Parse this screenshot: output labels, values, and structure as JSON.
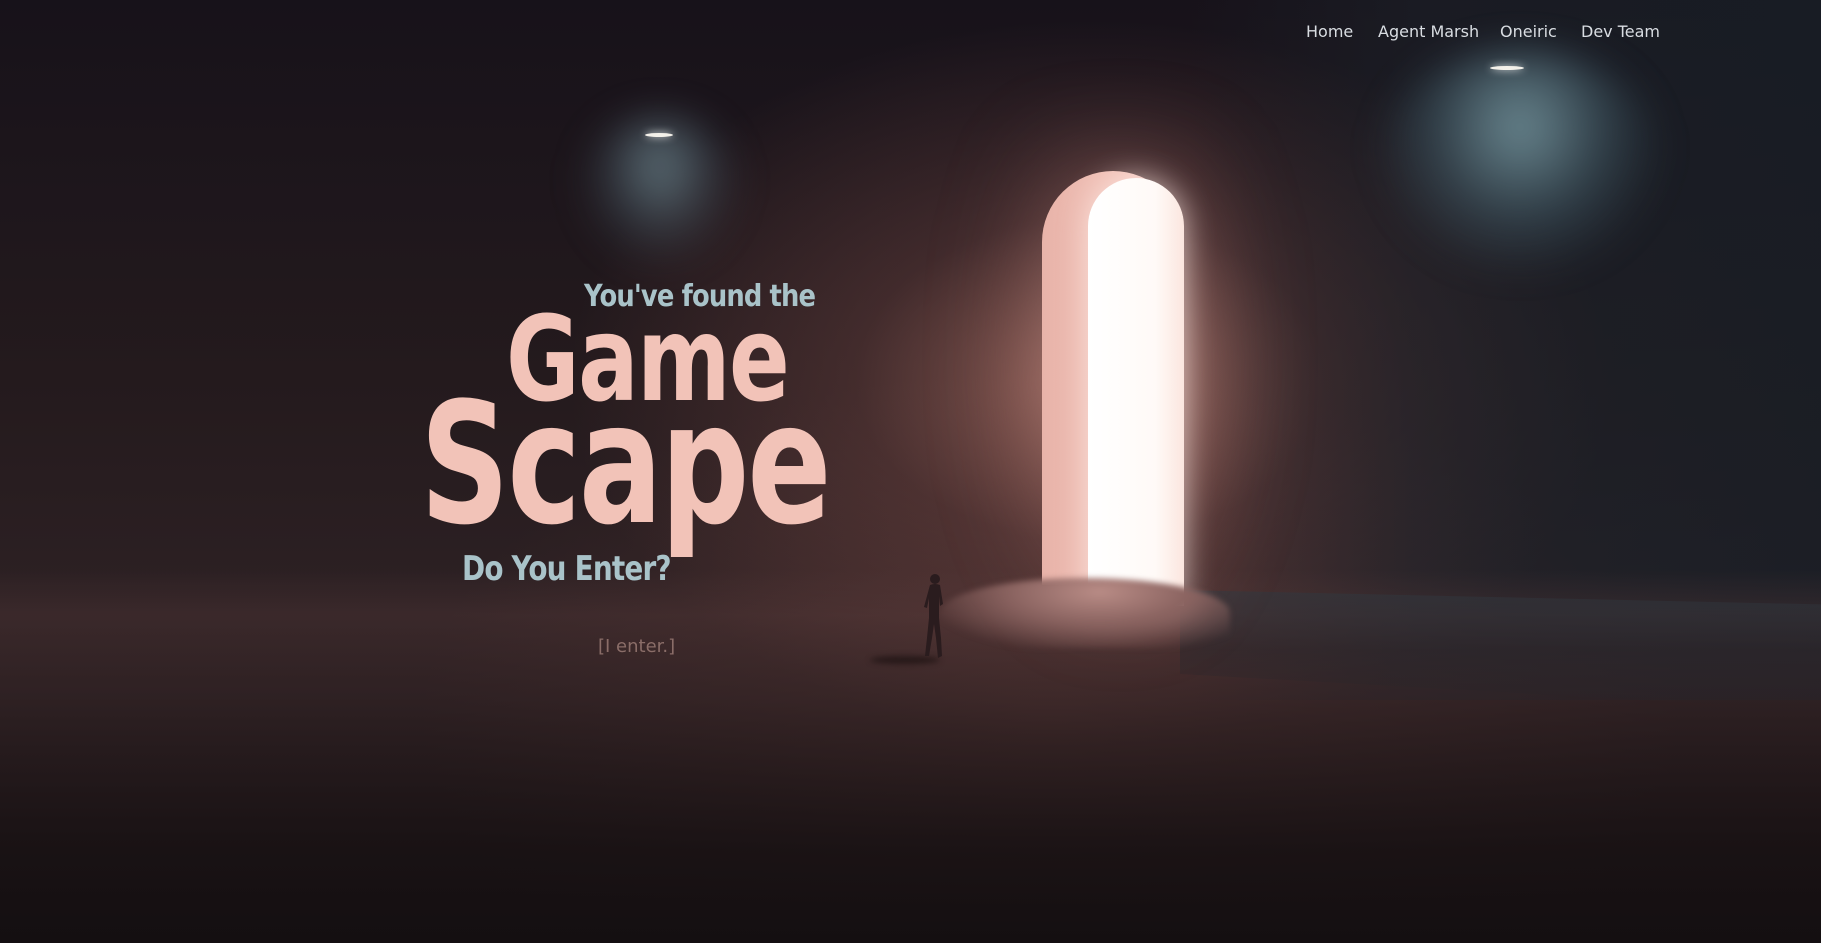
{
  "nav": {
    "items": [
      {
        "label": "Home"
      },
      {
        "label": "Agent Marsh"
      },
      {
        "label": "Oneiric"
      },
      {
        "label": "Dev Team"
      }
    ]
  },
  "hero": {
    "tagline_top": "You've found the",
    "title_line1": "Game",
    "title_line2": "Scape",
    "tagline_bottom": "Do You Enter?",
    "enter_label": "[I enter.]"
  },
  "colors": {
    "title": "#f2c3b8",
    "tagline": "#a9c3c9",
    "nav_text": "#d9dde2",
    "enter_link": "#8a6d68",
    "background": "#1a1416"
  },
  "icons": {
    "figure": "walking-person-silhouette",
    "doorway": "glowing-arch-doorway"
  }
}
